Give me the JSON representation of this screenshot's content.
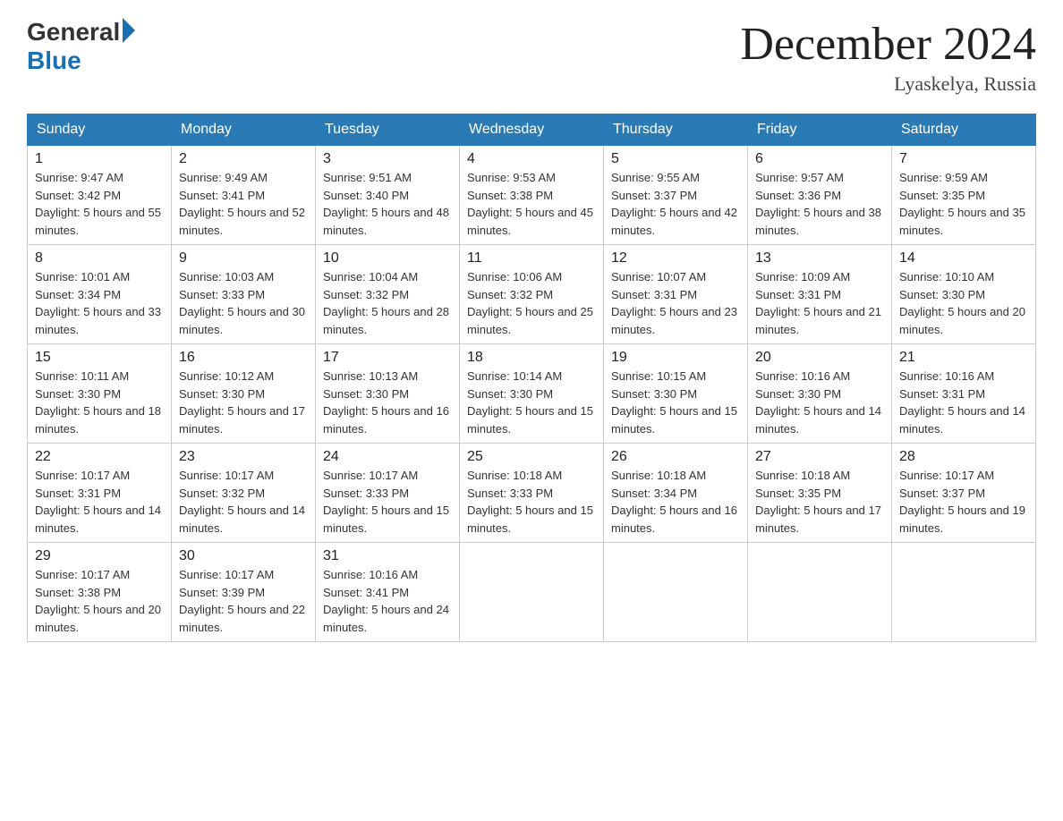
{
  "header": {
    "logo_general": "General",
    "logo_blue": "Blue",
    "month_title": "December 2024",
    "location": "Lyaskelya, Russia"
  },
  "days_of_week": [
    "Sunday",
    "Monday",
    "Tuesday",
    "Wednesday",
    "Thursday",
    "Friday",
    "Saturday"
  ],
  "weeks": [
    [
      {
        "day": "1",
        "sunrise": "9:47 AM",
        "sunset": "3:42 PM",
        "daylight": "5 hours and 55 minutes."
      },
      {
        "day": "2",
        "sunrise": "9:49 AM",
        "sunset": "3:41 PM",
        "daylight": "5 hours and 52 minutes."
      },
      {
        "day": "3",
        "sunrise": "9:51 AM",
        "sunset": "3:40 PM",
        "daylight": "5 hours and 48 minutes."
      },
      {
        "day": "4",
        "sunrise": "9:53 AM",
        "sunset": "3:38 PM",
        "daylight": "5 hours and 45 minutes."
      },
      {
        "day": "5",
        "sunrise": "9:55 AM",
        "sunset": "3:37 PM",
        "daylight": "5 hours and 42 minutes."
      },
      {
        "day": "6",
        "sunrise": "9:57 AM",
        "sunset": "3:36 PM",
        "daylight": "5 hours and 38 minutes."
      },
      {
        "day": "7",
        "sunrise": "9:59 AM",
        "sunset": "3:35 PM",
        "daylight": "5 hours and 35 minutes."
      }
    ],
    [
      {
        "day": "8",
        "sunrise": "10:01 AM",
        "sunset": "3:34 PM",
        "daylight": "5 hours and 33 minutes."
      },
      {
        "day": "9",
        "sunrise": "10:03 AM",
        "sunset": "3:33 PM",
        "daylight": "5 hours and 30 minutes."
      },
      {
        "day": "10",
        "sunrise": "10:04 AM",
        "sunset": "3:32 PM",
        "daylight": "5 hours and 28 minutes."
      },
      {
        "day": "11",
        "sunrise": "10:06 AM",
        "sunset": "3:32 PM",
        "daylight": "5 hours and 25 minutes."
      },
      {
        "day": "12",
        "sunrise": "10:07 AM",
        "sunset": "3:31 PM",
        "daylight": "5 hours and 23 minutes."
      },
      {
        "day": "13",
        "sunrise": "10:09 AM",
        "sunset": "3:31 PM",
        "daylight": "5 hours and 21 minutes."
      },
      {
        "day": "14",
        "sunrise": "10:10 AM",
        "sunset": "3:30 PM",
        "daylight": "5 hours and 20 minutes."
      }
    ],
    [
      {
        "day": "15",
        "sunrise": "10:11 AM",
        "sunset": "3:30 PM",
        "daylight": "5 hours and 18 minutes."
      },
      {
        "day": "16",
        "sunrise": "10:12 AM",
        "sunset": "3:30 PM",
        "daylight": "5 hours and 17 minutes."
      },
      {
        "day": "17",
        "sunrise": "10:13 AM",
        "sunset": "3:30 PM",
        "daylight": "5 hours and 16 minutes."
      },
      {
        "day": "18",
        "sunrise": "10:14 AM",
        "sunset": "3:30 PM",
        "daylight": "5 hours and 15 minutes."
      },
      {
        "day": "19",
        "sunrise": "10:15 AM",
        "sunset": "3:30 PM",
        "daylight": "5 hours and 15 minutes."
      },
      {
        "day": "20",
        "sunrise": "10:16 AM",
        "sunset": "3:30 PM",
        "daylight": "5 hours and 14 minutes."
      },
      {
        "day": "21",
        "sunrise": "10:16 AM",
        "sunset": "3:31 PM",
        "daylight": "5 hours and 14 minutes."
      }
    ],
    [
      {
        "day": "22",
        "sunrise": "10:17 AM",
        "sunset": "3:31 PM",
        "daylight": "5 hours and 14 minutes."
      },
      {
        "day": "23",
        "sunrise": "10:17 AM",
        "sunset": "3:32 PM",
        "daylight": "5 hours and 14 minutes."
      },
      {
        "day": "24",
        "sunrise": "10:17 AM",
        "sunset": "3:33 PM",
        "daylight": "5 hours and 15 minutes."
      },
      {
        "day": "25",
        "sunrise": "10:18 AM",
        "sunset": "3:33 PM",
        "daylight": "5 hours and 15 minutes."
      },
      {
        "day": "26",
        "sunrise": "10:18 AM",
        "sunset": "3:34 PM",
        "daylight": "5 hours and 16 minutes."
      },
      {
        "day": "27",
        "sunrise": "10:18 AM",
        "sunset": "3:35 PM",
        "daylight": "5 hours and 17 minutes."
      },
      {
        "day": "28",
        "sunrise": "10:17 AM",
        "sunset": "3:37 PM",
        "daylight": "5 hours and 19 minutes."
      }
    ],
    [
      {
        "day": "29",
        "sunrise": "10:17 AM",
        "sunset": "3:38 PM",
        "daylight": "5 hours and 20 minutes."
      },
      {
        "day": "30",
        "sunrise": "10:17 AM",
        "sunset": "3:39 PM",
        "daylight": "5 hours and 22 minutes."
      },
      {
        "day": "31",
        "sunrise": "10:16 AM",
        "sunset": "3:41 PM",
        "daylight": "5 hours and 24 minutes."
      },
      null,
      null,
      null,
      null
    ]
  ]
}
